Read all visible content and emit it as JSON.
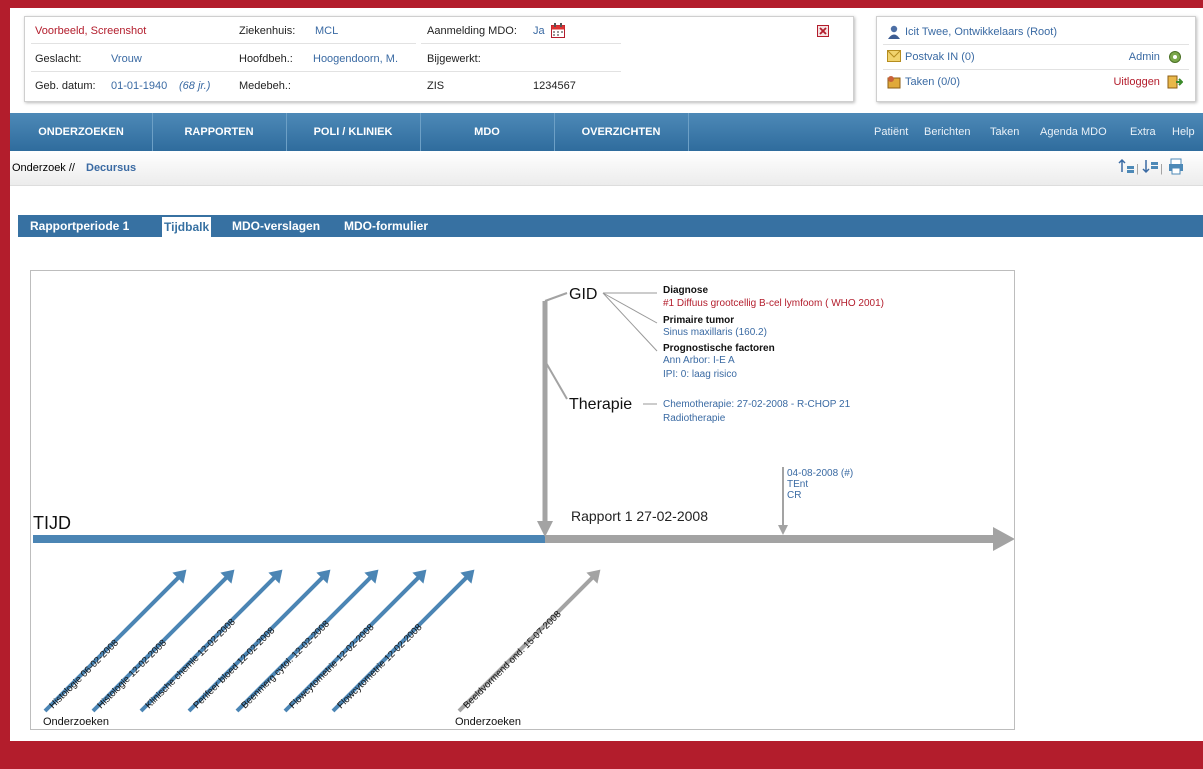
{
  "patient": {
    "name": "Voorbeeld, Screenshot",
    "gender_label": "Geslacht:",
    "gender": "Vrouw",
    "dob_label": "Geb. datum:",
    "dob": "01-01-1940",
    "age": "(68 jr.)",
    "hospital_label": "Ziekenhuis:",
    "hospital": "MCL",
    "hoofdbeh_label": "Hoofdbeh.:",
    "hoofdbeh": "Hoogendoorn, M.",
    "medebeh_label": "Medebeh.:",
    "mdo_label": "Aanmelding MDO:",
    "mdo": "Ja",
    "bijgewerkt_label": "Bijgewerkt:",
    "zis_label": "ZIS",
    "zis": "1234567"
  },
  "user": {
    "name": "Icit Twee, Ontwikkelaars (Root)",
    "postvak": "Postvak IN (0)",
    "taken": "Taken (0/0)",
    "admin": "Admin",
    "logout": "Uitloggen"
  },
  "nav": {
    "main": [
      "ONDERZOEKEN",
      "RAPPORTEN",
      "POLI / KLINIEK",
      "MDO",
      "OVERZICHTEN"
    ],
    "right": [
      "Patiënt",
      "Berichten",
      "Taken",
      "Agenda MDO",
      "Extra",
      "Help"
    ]
  },
  "breadcrumb": {
    "parent": "Onderzoek //",
    "current": "Decursus"
  },
  "tabs": [
    "Rapportperiode 1",
    "Tijdbalk",
    "MDO-verslagen",
    "MDO-formulier"
  ],
  "active_tab": 1,
  "timeline": {
    "axis_label": "TIJD",
    "report": "Rapport 1  27-02-2008",
    "gid": "GID",
    "diagnose_title": "Diagnose",
    "diagnose_value": "#1 Diffuus grootcellig  B-cel lymfoom  ( WHO 2001)",
    "tumor_title": "Primaire tumor",
    "tumor_value": "Sinus maxillaris (160.2)",
    "prog_title": "Prognostische factoren",
    "prog_value1": "Ann Arbor: I-E A",
    "prog_value2": "IPI: 0: laag risico",
    "therapie": "Therapie",
    "ther_value1": "Chemotherapie: 27-02-2008 - R-CHOP 21",
    "ther_value2": "Radiotherapie",
    "event_date": "04-08-2008 (#)",
    "event_line2": "TEnt",
    "event_line3": "CR",
    "onderzoeken_label": "Onderzoeken",
    "investigations": [
      "Histologie 06-02-2008",
      "Histologie 12-02-2008",
      "Klinische chemie 12-02-2008",
      "Perifeer bloed 12-02-2008",
      "Beenmerg cytol. 12-02-2008",
      "Flowcytometrie 12-02-2008",
      "Flowcytometrie 12-02-2008"
    ],
    "later_investigation": "Beeldvormend ond. 15-07-2008"
  },
  "colors": {
    "brand_red": "#b31d2c",
    "nav_blue": "#3771a2",
    "link_blue": "#3a6aa3",
    "timeline_blue": "#4b85b4",
    "timeline_grey": "#a3a3a3"
  }
}
